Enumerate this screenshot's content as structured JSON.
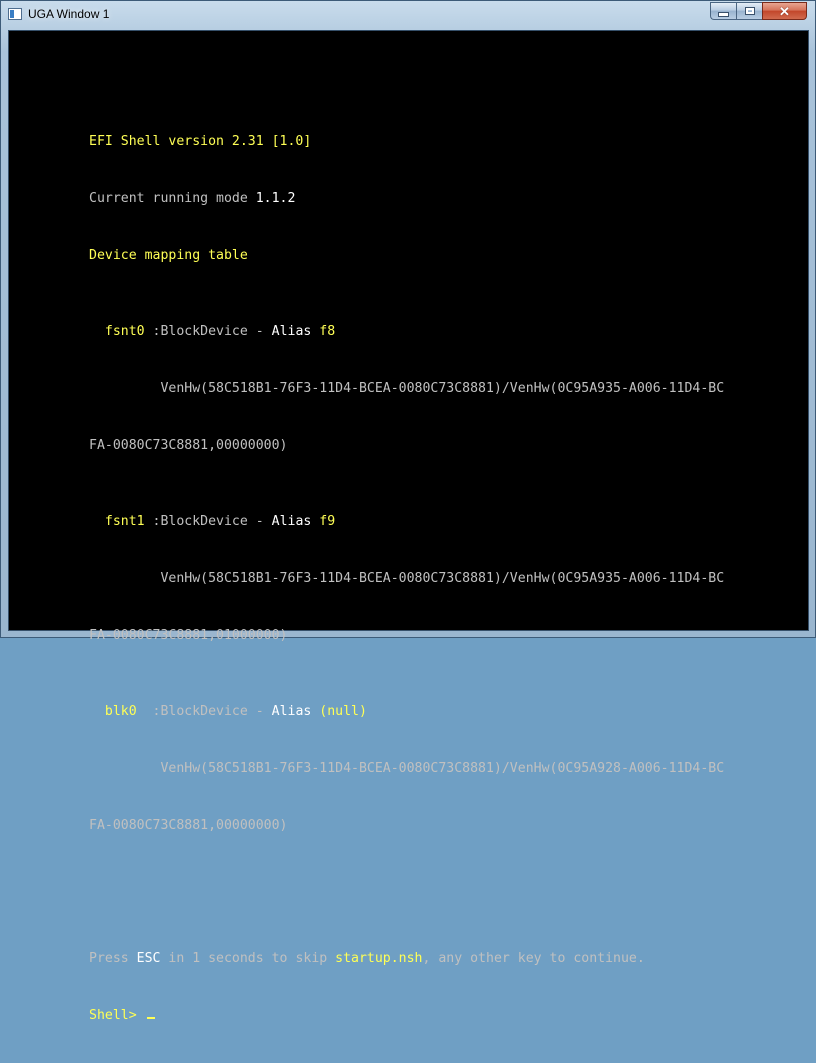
{
  "window": {
    "title": "UGA Window 1",
    "buttons": {
      "minimize": "minimize",
      "maximize": "maximize",
      "close": "✕"
    }
  },
  "terminal": {
    "line1": "EFI Shell version 2.31 [1.0]",
    "line2_label": "Current running mode ",
    "line2_value": "1.1.2",
    "line3": "Device mapping table",
    "devices": [
      {
        "name": "fsnt0",
        "type": " :BlockDevice - ",
        "alias_label": "Alias ",
        "alias": "f8",
        "path1": "VenHw(58C518B1-76F3-11D4-BCEA-0080C73C8881)/VenHw(0C95A935-A006-11D4-BC",
        "path2": "FA-0080C73C8881,00000000)"
      },
      {
        "name": "fsnt1",
        "type": " :BlockDevice - ",
        "alias_label": "Alias ",
        "alias": "f9",
        "path1": "VenHw(58C518B1-76F3-11D4-BCEA-0080C73C8881)/VenHw(0C95A935-A006-11D4-BC",
        "path2": "FA-0080C73C8881,01000000)"
      },
      {
        "name": "blk0",
        "type": "  :BlockDevice - ",
        "alias_label": "Alias ",
        "alias": "(null)",
        "path1": "VenHw(58C518B1-76F3-11D4-BCEA-0080C73C8881)/VenHw(0C95A928-A006-11D4-BC",
        "path2": "FA-0080C73C8881,00000000)"
      }
    ],
    "press_1": "Press ",
    "press_esc": "ESC",
    "press_2": " in 1 seconds to skip ",
    "press_file": "startup.nsh",
    "press_3": ", any other key to continue.",
    "prompt": "Shell> "
  },
  "colors": {
    "yellow": "#ffff55",
    "white": "#ffffff",
    "gray": "#c0c0c0",
    "background": "#000000"
  }
}
